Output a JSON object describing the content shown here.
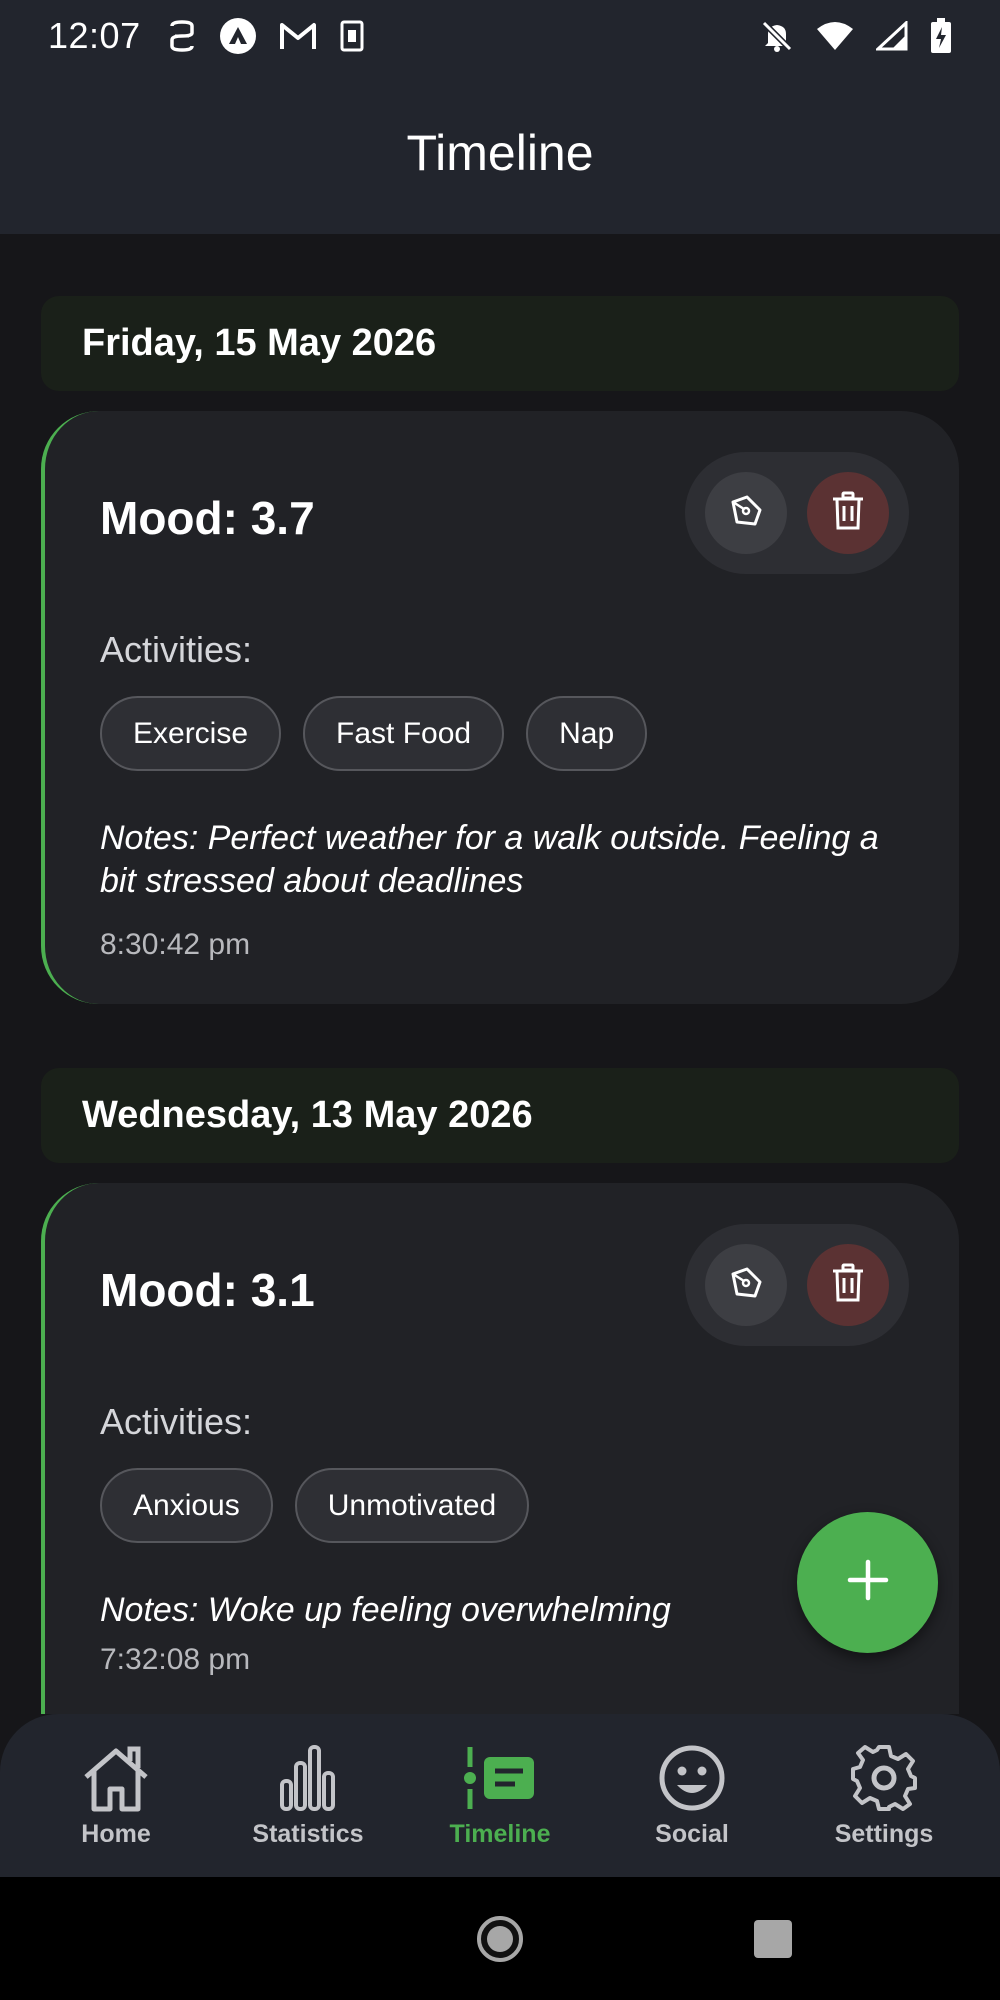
{
  "status_bar": {
    "time": "12:07",
    "left_icons": [
      "subtitles-icon",
      "app-logo-icon",
      "gmail-icon",
      "sim-card-icon"
    ],
    "right_icons": [
      "notifications-off-icon",
      "wifi-icon",
      "cellular-signal-icon",
      "battery-charging-icon"
    ]
  },
  "app_bar": {
    "title": "Timeline"
  },
  "entries": [
    {
      "date": "Friday, 15 May 2026",
      "mood": "Mood: 3.7",
      "activities_label": "Activities:",
      "activities": [
        "Exercise",
        "Fast Food",
        "Nap"
      ],
      "notes": "Notes: Perfect weather for a walk outside. Feeling a bit stressed about deadlines",
      "time": "8:30:42 pm"
    },
    {
      "date": "Wednesday, 13 May 2026",
      "mood": "Mood: 3.1",
      "activities_label": "Activities:",
      "activities": [
        "Anxious",
        "Unmotivated"
      ],
      "notes": "Notes: Woke up feeling overwhelming",
      "time": "7:32:08 pm"
    }
  ],
  "fab": {
    "icon": "plus-icon"
  },
  "bottom_nav": {
    "items": [
      {
        "label": "Home",
        "icon": "home-icon",
        "active": false
      },
      {
        "label": "Statistics",
        "icon": "bar-chart-icon",
        "active": false
      },
      {
        "label": "Timeline",
        "icon": "timeline-icon",
        "active": true
      },
      {
        "label": "Social",
        "icon": "smiley-icon",
        "active": false
      },
      {
        "label": "Settings",
        "icon": "gear-icon",
        "active": false
      }
    ]
  },
  "colors": {
    "accent": "#4caf50",
    "background": "#161619",
    "card": "#212226",
    "bar": "#22252d",
    "delete": "#5b3233"
  }
}
